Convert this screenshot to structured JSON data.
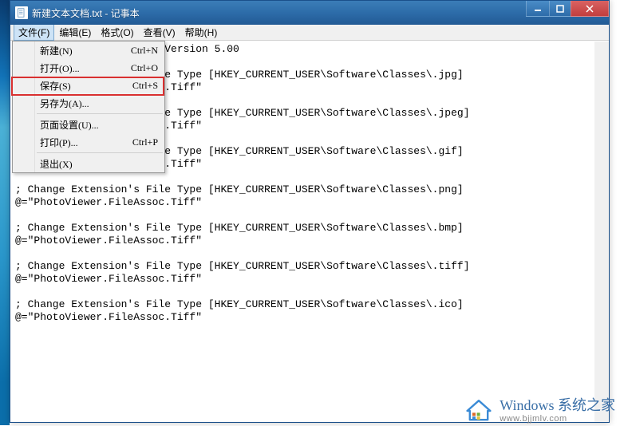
{
  "window": {
    "title": "新建文本文档.txt - 记事本"
  },
  "menubar": {
    "items": [
      {
        "label": "文件(F)"
      },
      {
        "label": "编辑(E)"
      },
      {
        "label": "格式(O)"
      },
      {
        "label": "查看(V)"
      },
      {
        "label": "帮助(H)"
      }
    ]
  },
  "fileMenu": {
    "items": [
      {
        "label": "新建(N)",
        "shortcut": "Ctrl+N"
      },
      {
        "label": "打开(O)...",
        "shortcut": "Ctrl+O"
      },
      {
        "label": "保存(S)",
        "shortcut": "Ctrl+S"
      },
      {
        "label": "另存为(A)...",
        "shortcut": ""
      },
      {
        "label": "页面设置(U)...",
        "shortcut": ""
      },
      {
        "label": "打印(P)...",
        "shortcut": "Ctrl+P"
      },
      {
        "label": "退出(X)",
        "shortcut": ""
      }
    ],
    "highlightIndex": 2
  },
  "editor": {
    "content": "Windows Registry Editor Version 5.00\n\n; Change Extension's File Type [HKEY_CURRENT_USER\\Software\\Classes\\.jpg]\n@=\"PhotoViewer.FileAssoc.Tiff\"\n\n; Change Extension's File Type [HKEY_CURRENT_USER\\Software\\Classes\\.jpeg]\n@=\"PhotoViewer.FileAssoc.Tiff\"\n\n; Change Extension's File Type [HKEY_CURRENT_USER\\Software\\Classes\\.gif]\n@=\"PhotoViewer.FileAssoc.Tiff\"\n\n; Change Extension's File Type [HKEY_CURRENT_USER\\Software\\Classes\\.png]\n@=\"PhotoViewer.FileAssoc.Tiff\"\n\n; Change Extension's File Type [HKEY_CURRENT_USER\\Software\\Classes\\.bmp]\n@=\"PhotoViewer.FileAssoc.Tiff\"\n\n; Change Extension's File Type [HKEY_CURRENT_USER\\Software\\Classes\\.tiff]\n@=\"PhotoViewer.FileAssoc.Tiff\"\n\n; Change Extension's File Type [HKEY_CURRENT_USER\\Software\\Classes\\.ico]\n@=\"PhotoViewer.FileAssoc.Tiff\""
  },
  "watermark": {
    "brand_en": "Windows",
    "brand_cn": "系统之家",
    "url": "www.bjjmlv.com"
  }
}
